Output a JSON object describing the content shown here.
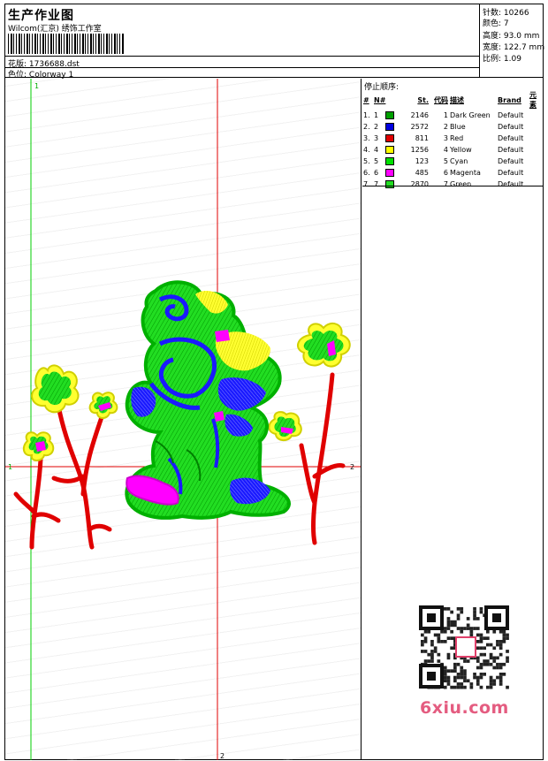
{
  "header": {
    "title": "生产作业图",
    "company": "Wilcom(汇京) 绣饰工作室",
    "design_label": "花版:",
    "design_file": "1736688.dst",
    "colorway_label": "色位:",
    "colorway": "Colorway 1"
  },
  "stats": [
    {
      "label": "针数:",
      "value": "10266"
    },
    {
      "label": "颜色:",
      "value": "7"
    },
    {
      "label": "高度:",
      "value": "93.0 mm"
    },
    {
      "label": "宽度:",
      "value": "122.7 mm"
    },
    {
      "label": "比例:",
      "value": "1.09"
    }
  ],
  "stop_sequence": {
    "title": "停止顺序:",
    "columns": [
      "#",
      "N#",
      "St.",
      "代码",
      "描述",
      "Brand",
      "元素"
    ],
    "rows": [
      {
        "num": "1.",
        "n": "1",
        "color": "#00a000",
        "st": "2146",
        "code": "1",
        "desc": "Dark Green",
        "brand": "Default"
      },
      {
        "num": "2.",
        "n": "2",
        "color": "#0000e0",
        "st": "2572",
        "code": "2",
        "desc": "Blue",
        "brand": "Default"
      },
      {
        "num": "3.",
        "n": "3",
        "color": "#e00000",
        "st": "811",
        "code": "3",
        "desc": "Red",
        "brand": "Default"
      },
      {
        "num": "4.",
        "n": "4",
        "color": "#ffff00",
        "st": "1256",
        "code": "4",
        "desc": "Yellow",
        "brand": "Default"
      },
      {
        "num": "5.",
        "n": "5",
        "color": "#00e000",
        "st": "123",
        "code": "5",
        "desc": "Cyan",
        "brand": "Default"
      },
      {
        "num": "6.",
        "n": "6",
        "color": "#ff00ff",
        "st": "485",
        "code": "6",
        "desc": "Magenta",
        "brand": "Default"
      },
      {
        "num": "7.",
        "n": "7",
        "color": "#22dd22",
        "st": "2870",
        "code": "7",
        "desc": "Green",
        "brand": "Default"
      }
    ]
  },
  "guides": {
    "vertical_label": "1",
    "horizontal_label_left": "1",
    "horizontal_label_right": "2",
    "bottom_label": "2"
  },
  "watermark": "6xiu.com"
}
